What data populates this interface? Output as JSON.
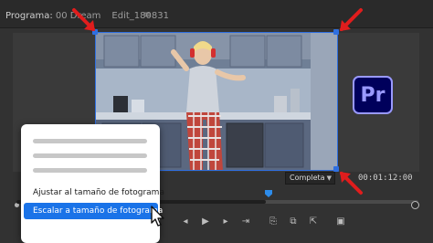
{
  "panel": {
    "title_prefix": "Programa:",
    "sequence_name": "00 Dream",
    "sequence_name_tail": "Edit_180831",
    "menu_icon": "hamburger-icon"
  },
  "logo": {
    "text": "Pr",
    "bg": "#00005b",
    "fg": "#9999ff"
  },
  "viewer": {
    "zoom_value": "Completa",
    "timecode": "00:01:12:00",
    "selection_color": "#2f6fe0",
    "arrow_color": "#e01d1d"
  },
  "context_menu": {
    "items": [
      {
        "label": "Ajustar al tamaño de fotograma"
      },
      {
        "label": "Escalar a tamaño de fotograma"
      }
    ],
    "selected_index": 1
  },
  "transport": {
    "buttons": [
      "mark-in-icon",
      "step-back-icon",
      "play-icon",
      "step-forward-icon",
      "mark-out-icon",
      "lift-icon",
      "extract-icon",
      "export-frame-icon",
      "camera-icon",
      "compare-icon"
    ]
  },
  "timeline": {
    "progress": 0.62
  },
  "colors": {
    "accent": "#1a73e8",
    "playhead": "#2d8ceb"
  }
}
